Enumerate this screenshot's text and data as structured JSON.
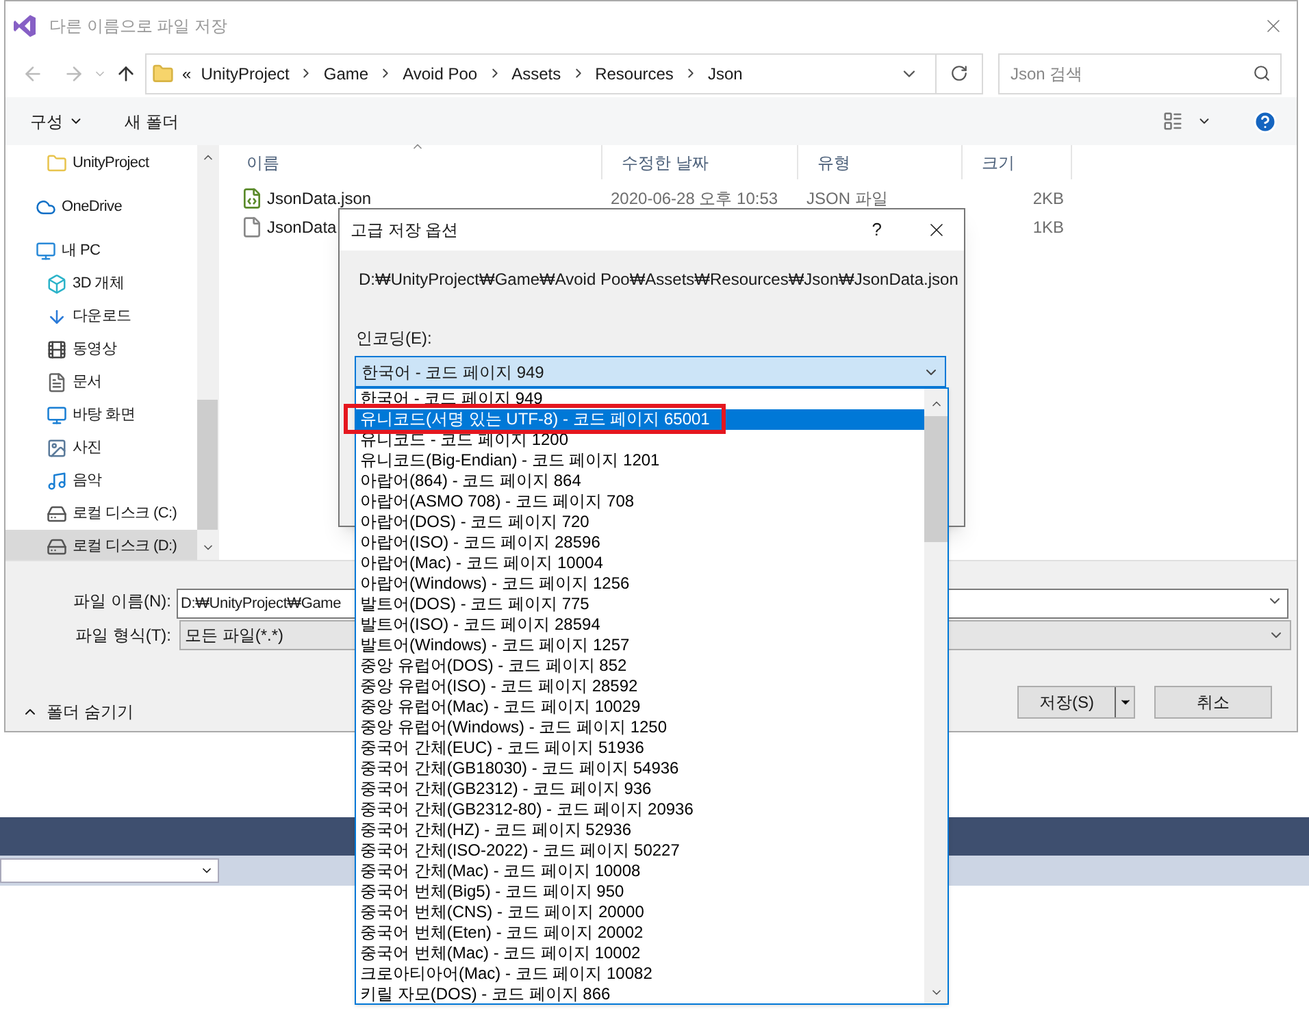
{
  "window": {
    "title": "다른 이름으로 파일 저장"
  },
  "address": {
    "overflow": "«",
    "path": [
      "UnityProject",
      "Game",
      "Avoid Poo",
      "Assets",
      "Resources",
      "Json"
    ],
    "search_placeholder": "Json 검색"
  },
  "toolbar": {
    "organize": "구성",
    "new_folder": "새 폴더"
  },
  "sidebar": {
    "items": [
      {
        "label": "UnityProject",
        "kind": "folder",
        "selected": false
      },
      {
        "label": "OneDrive",
        "kind": "cloud",
        "selected": false
      },
      {
        "label": "내 PC",
        "kind": "pc",
        "selected": false
      },
      {
        "label": "3D 개체",
        "kind": "cube",
        "selected": false
      },
      {
        "label": "다운로드",
        "kind": "download",
        "selected": false
      },
      {
        "label": "동영상",
        "kind": "video",
        "selected": false
      },
      {
        "label": "문서",
        "kind": "document",
        "selected": false
      },
      {
        "label": "바탕 화면",
        "kind": "desktop",
        "selected": false
      },
      {
        "label": "사진",
        "kind": "photo",
        "selected": false
      },
      {
        "label": "음악",
        "kind": "music",
        "selected": false
      },
      {
        "label": "로컬 디스크 (C:)",
        "kind": "drive",
        "selected": false
      },
      {
        "label": "로컬 디스크 (D:)",
        "kind": "drive",
        "selected": true
      }
    ]
  },
  "table": {
    "columns": [
      "이름",
      "수정한 날짜",
      "유형",
      "크기"
    ],
    "rows": [
      {
        "kind": "script",
        "name": "JsonData.json",
        "date": "2020-06-28 오후 10:53",
        "type": "JSON 파일",
        "size": "2KB"
      },
      {
        "kind": "file",
        "name": "JsonData",
        "size": "1KB"
      }
    ]
  },
  "file_name": {
    "label": "파일 이름(N):",
    "value": "D:₩UnityProject₩Game"
  },
  "file_type": {
    "label": "파일 형식(T):",
    "value": "모든 파일(*.*)"
  },
  "hide_folders": "폴더 숨기기",
  "buttons": {
    "save": "저장(S)",
    "cancel": "취소"
  },
  "dialog": {
    "title": "고급 저장 옵션",
    "help": "?",
    "path": "D:₩UnityProject₩Game₩Avoid Poo₩Assets₩Resources₩Json₩JsonData.json",
    "encoding_label": "인코딩(E):",
    "encoding_value": "한국어 - 코드 페이지 949",
    "options": [
      {
        "label": "한국어 - 코드 페이지 949",
        "selected": false
      },
      {
        "label": "유니코드(서명 있는 UTF-8) - 코드 페이지 65001",
        "selected": true
      },
      {
        "label": "유니코드 - 코드 페이지 1200",
        "selected": false
      },
      {
        "label": "유니코드(Big-Endian) - 코드 페이지 1201",
        "selected": false
      },
      {
        "label": "아랍어(864) - 코드 페이지 864",
        "selected": false
      },
      {
        "label": "아랍어(ASMO 708) - 코드 페이지 708",
        "selected": false
      },
      {
        "label": "아랍어(DOS) - 코드 페이지 720",
        "selected": false
      },
      {
        "label": "아랍어(ISO) - 코드 페이지 28596",
        "selected": false
      },
      {
        "label": "아랍어(Mac) - 코드 페이지 10004",
        "selected": false
      },
      {
        "label": "아랍어(Windows) - 코드 페이지 1256",
        "selected": false
      },
      {
        "label": "발트어(DOS) - 코드 페이지 775",
        "selected": false
      },
      {
        "label": "발트어(ISO) - 코드 페이지 28594",
        "selected": false
      },
      {
        "label": "발트어(Windows) - 코드 페이지 1257",
        "selected": false
      },
      {
        "label": "중앙 유럽어(DOS) - 코드 페이지 852",
        "selected": false
      },
      {
        "label": "중앙 유럽어(ISO) - 코드 페이지 28592",
        "selected": false
      },
      {
        "label": "중앙 유럽어(Mac) - 코드 페이지 10029",
        "selected": false
      },
      {
        "label": "중앙 유럽어(Windows) - 코드 페이지 1250",
        "selected": false
      },
      {
        "label": "중국어 간체(EUC) - 코드 페이지 51936",
        "selected": false
      },
      {
        "label": "중국어 간체(GB18030) - 코드 페이지 54936",
        "selected": false
      },
      {
        "label": "중국어 간체(GB2312) - 코드 페이지 936",
        "selected": false
      },
      {
        "label": "중국어 간체(GB2312-80) - 코드 페이지 20936",
        "selected": false
      },
      {
        "label": "중국어 간체(HZ) - 코드 페이지 52936",
        "selected": false
      },
      {
        "label": "중국어 간체(ISO-2022) - 코드 페이지 50227",
        "selected": false
      },
      {
        "label": "중국어 간체(Mac) - 코드 페이지 10008",
        "selected": false
      },
      {
        "label": "중국어 번체(Big5) - 코드 페이지 950",
        "selected": false
      },
      {
        "label": "중국어 번체(CNS) - 코드 페이지 20000",
        "selected": false
      },
      {
        "label": "중국어 번체(Eten) - 코드 페이지 20002",
        "selected": false
      },
      {
        "label": "중국어 번체(Mac) - 코드 페이지 10002",
        "selected": false
      },
      {
        "label": "크로아티아어(Mac) - 코드 페이지 10082",
        "selected": false
      },
      {
        "label": "키릴 자모(DOS) - 코드 페이지 866",
        "selected": false
      }
    ]
  }
}
